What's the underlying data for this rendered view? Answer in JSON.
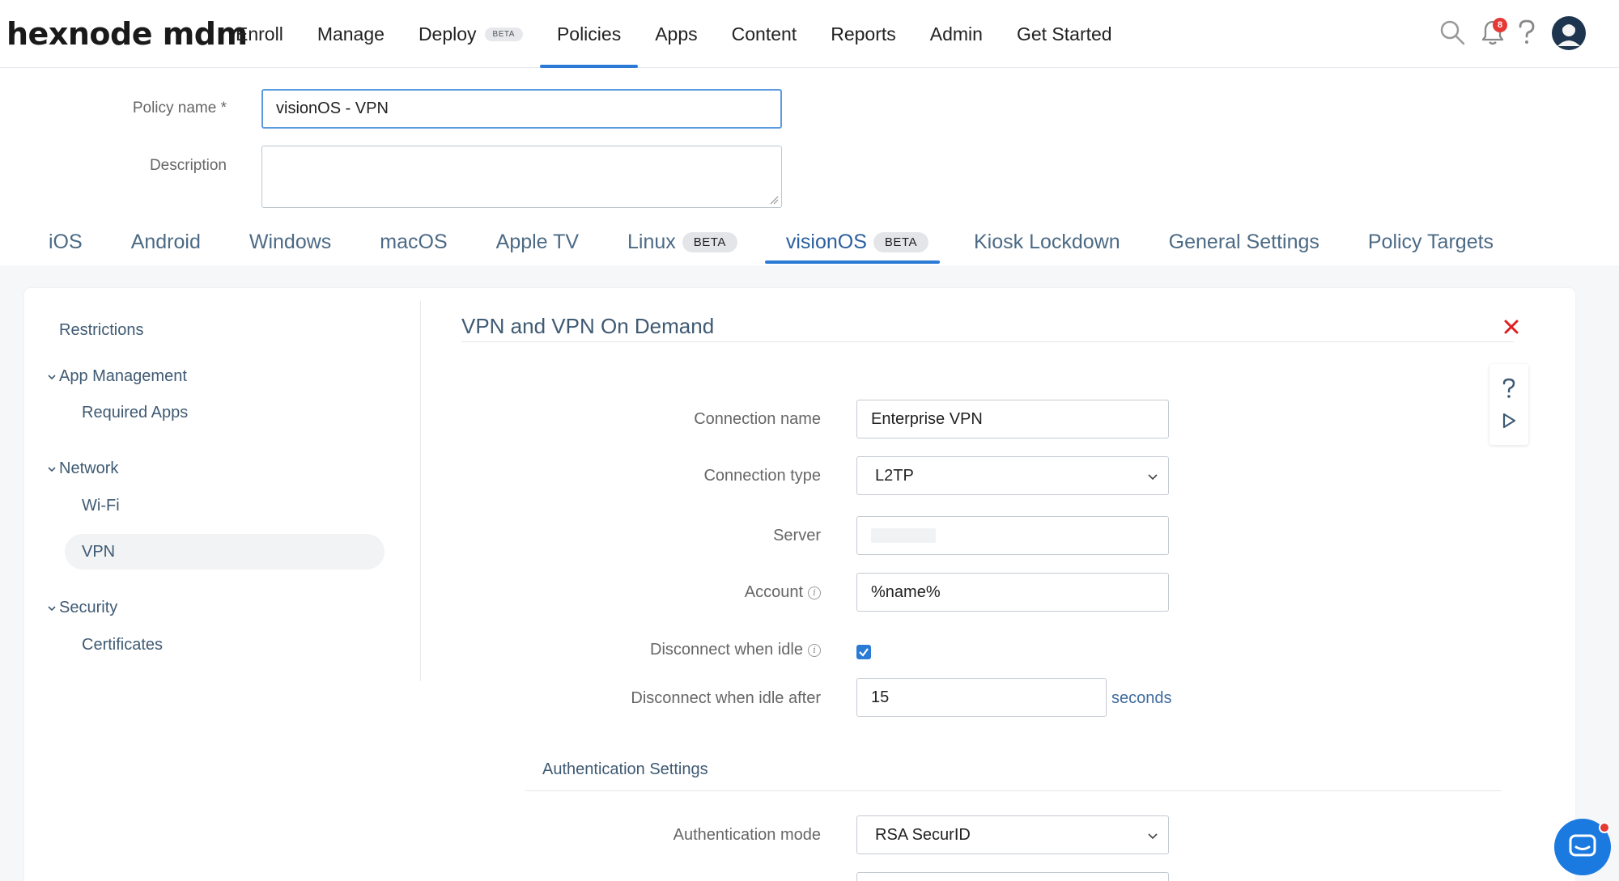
{
  "app": {
    "logo": "hexnode mdm"
  },
  "topnav": {
    "items": [
      {
        "label": "Enroll"
      },
      {
        "label": "Manage"
      },
      {
        "label": "Deploy",
        "badge": "BETA"
      },
      {
        "label": "Policies"
      },
      {
        "label": "Apps"
      },
      {
        "label": "Content"
      },
      {
        "label": "Reports"
      },
      {
        "label": "Admin"
      },
      {
        "label": "Get Started"
      }
    ],
    "active": "Policies",
    "notification_count": "8",
    "icons": [
      "search-icon",
      "bell-icon",
      "help-icon",
      "avatar"
    ]
  },
  "policy": {
    "name_label": "Policy name *",
    "name_value": "visionOS - VPN",
    "description_label": "Description",
    "description_value": ""
  },
  "platform_tabs": [
    {
      "label": "iOS"
    },
    {
      "label": "Android"
    },
    {
      "label": "Windows"
    },
    {
      "label": "macOS"
    },
    {
      "label": "Apple TV"
    },
    {
      "label": "Linux",
      "badge": "BETA"
    },
    {
      "label": "visionOS",
      "badge": "BETA"
    },
    {
      "label": "Kiosk Lockdown"
    },
    {
      "label": "General Settings"
    },
    {
      "label": "Policy Targets"
    }
  ],
  "active_platform": "visionOS",
  "sidebar": {
    "restrictions": "Restrictions",
    "app_management": "App Management",
    "required_apps": "Required Apps",
    "network": "Network",
    "wifi": "Wi-Fi",
    "vpn": "VPN",
    "security": "Security",
    "certificates": "Certificates",
    "active": "VPN"
  },
  "panel": {
    "title": "VPN and VPN On Demand",
    "connection_name_label": "Connection name",
    "connection_name_value": "Enterprise VPN",
    "connection_type_label": "Connection type",
    "connection_type_value": "L2TP",
    "server_label": "Server",
    "server_value": "",
    "account_label": "Account",
    "account_value": "%name%",
    "disconnect_idle_label": "Disconnect when idle",
    "disconnect_idle_checked": true,
    "disconnect_after_label": "Disconnect when idle after",
    "disconnect_after_value": "15",
    "seconds_label": "seconds",
    "auth_section_title": "Authentication Settings",
    "auth_mode_label": "Authentication mode",
    "auth_mode_value": "RSA SecurID"
  },
  "colors": {
    "accent": "#2b7bd6",
    "close": "#e02020",
    "badge": "#e53935",
    "chat": "#1b7ae0"
  }
}
